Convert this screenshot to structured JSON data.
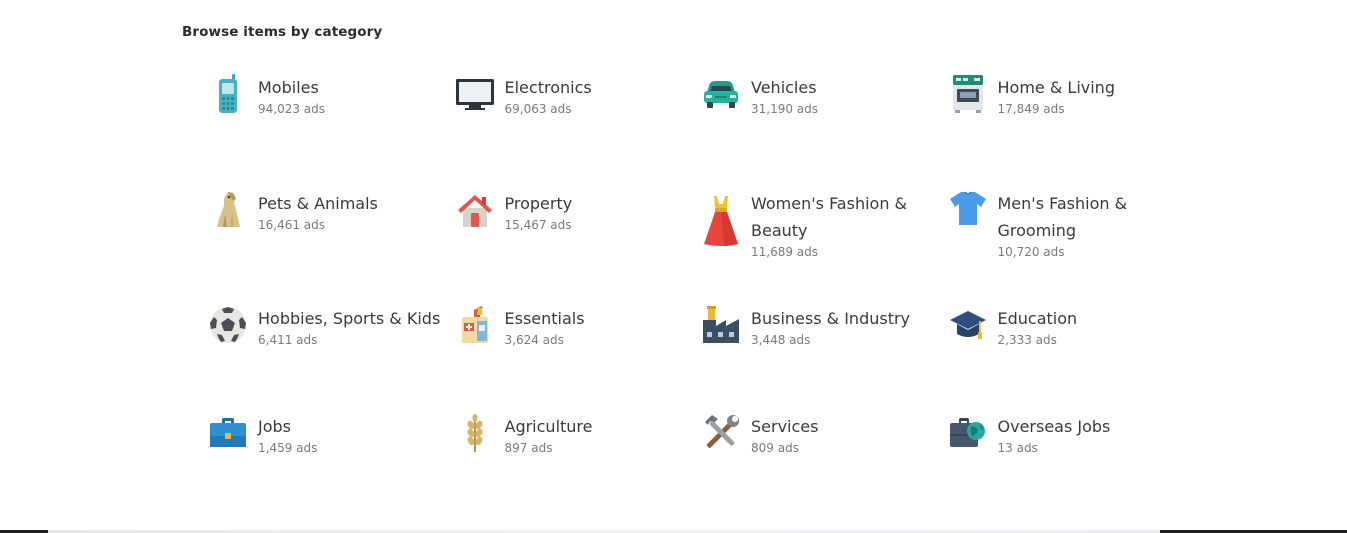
{
  "section_title": "Browse items by category",
  "categories": [
    {
      "name": "Mobiles",
      "count": "94,023 ads",
      "icon": "mobile-phone-icon"
    },
    {
      "name": "Electronics",
      "count": "69,063 ads",
      "icon": "tv-monitor-icon"
    },
    {
      "name": "Vehicles",
      "count": "31,190 ads",
      "icon": "car-icon"
    },
    {
      "name": "Home & Living",
      "count": "17,849 ads",
      "icon": "stove-icon"
    },
    {
      "name": "Pets & Animals",
      "count": "16,461 ads",
      "icon": "dog-icon"
    },
    {
      "name": "Property",
      "count": "15,467 ads",
      "icon": "house-icon"
    },
    {
      "name": "Women's Fashion & Beauty",
      "count": "11,689 ads",
      "icon": "dress-icon"
    },
    {
      "name": "Men's Fashion & Grooming",
      "count": "10,720 ads",
      "icon": "tshirt-icon"
    },
    {
      "name": "Hobbies, Sports & Kids",
      "count": "6,411 ads",
      "icon": "soccer-ball-icon"
    },
    {
      "name": "Essentials",
      "count": "3,624 ads",
      "icon": "grocery-bag-icon"
    },
    {
      "name": "Business & Industry",
      "count": "3,448 ads",
      "icon": "factory-icon"
    },
    {
      "name": "Education",
      "count": "2,333 ads",
      "icon": "graduation-cap-icon"
    },
    {
      "name": "Jobs",
      "count": "1,459 ads",
      "icon": "briefcase-icon"
    },
    {
      "name": "Agriculture",
      "count": "897 ads",
      "icon": "wheat-icon"
    },
    {
      "name": "Services",
      "count": "809 ads",
      "icon": "tools-icon"
    },
    {
      "name": "Overseas Jobs",
      "count": "13 ads",
      "icon": "globe-briefcase-icon"
    }
  ]
}
